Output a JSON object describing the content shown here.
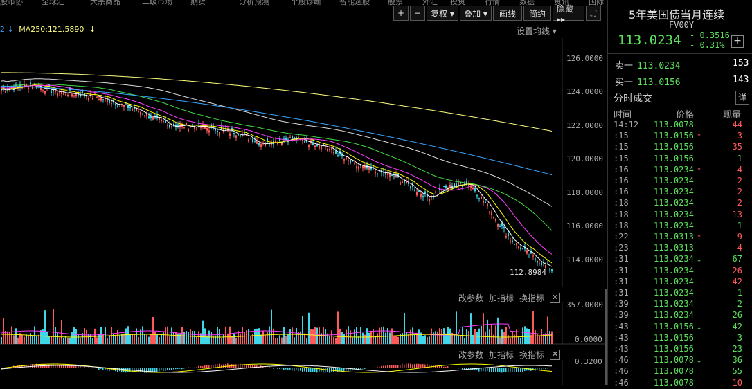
{
  "nav": {
    "items": [
      "股市协",
      "全球汇",
      "大宗商品",
      "二级市场",
      "期货",
      "分析预测",
      "个股诊断",
      "智能选股",
      "股票",
      "外汇",
      "投资",
      "行情",
      "数据",
      "资讯",
      "国际"
    ]
  },
  "toolbar": {
    "plus": "+",
    "minus": "−",
    "fuquan": "复权 ▾",
    "diejia": "叠加 ▾",
    "huaxian": "画线",
    "jianyue": "简约",
    "yincang": "隐藏 ▸▸",
    "fullscreen": "⛶"
  },
  "ma_bar": {
    "prefix": "2 ↓",
    "ma250": "MA250:121.5890",
    "arrow": "↓",
    "set_ma": "设置均线 ▾"
  },
  "y_axis": [
    "126.0000",
    "124.0000",
    "122.0000",
    "120.0000",
    "118.0000",
    "116.0000",
    "114.0000"
  ],
  "latest_label": "112.8984",
  "volume_panel": {
    "gaicanshu": "改参数",
    "jiazhibiao": "加指标",
    "huanzhibiao": "换指标",
    "close": "✕",
    "max": "357.0000",
    "min": "0.0000"
  },
  "macd_panel": {
    "gaicanshu": "改参数",
    "jiazhibiao": "加指标",
    "huanzhibiao": "换指标",
    "close": "✕",
    "max": "0.3200"
  },
  "side": {
    "title": "5年美国债当月连续",
    "code": "FV00Y",
    "price": "113.0234",
    "change": "- 0.3516",
    "change_pct": "- 0.31%",
    "plus": "+",
    "ask_label": "卖一",
    "ask_price": "113.0234",
    "ask_vol": "153",
    "bid_label": "买一",
    "bid_price": "113.0156",
    "bid_vol": "143",
    "ticks_title": "分时成交",
    "detail": "详",
    "col_time": "时间",
    "col_price": "价格",
    "col_vol": "现量"
  },
  "ticks": [
    {
      "t": "14:12",
      "p": "113.0078",
      "a": "",
      "v": "44",
      "c": "up"
    },
    {
      "t": ":15",
      "p": "113.0156",
      "a": "↑",
      "v": "3",
      "c": "up"
    },
    {
      "t": ":15",
      "p": "113.0156",
      "a": "",
      "v": "35",
      "c": "up"
    },
    {
      "t": ":15",
      "p": "113.0156",
      "a": "",
      "v": "1",
      "c": "dn"
    },
    {
      "t": ":16",
      "p": "113.0234",
      "a": "↑",
      "v": "4",
      "c": "up"
    },
    {
      "t": ":16",
      "p": "113.0234",
      "a": "",
      "v": "2",
      "c": "up"
    },
    {
      "t": ":16",
      "p": "113.0234",
      "a": "",
      "v": "2",
      "c": "up"
    },
    {
      "t": ":18",
      "p": "113.0234",
      "a": "",
      "v": "2",
      "c": "up"
    },
    {
      "t": ":18",
      "p": "113.0234",
      "a": "",
      "v": "13",
      "c": "up"
    },
    {
      "t": ":18",
      "p": "113.0234",
      "a": "",
      "v": "1",
      "c": "dn"
    },
    {
      "t": ":22",
      "p": "113.0313",
      "a": "↑",
      "v": "9",
      "c": "up"
    },
    {
      "t": ":23",
      "p": "113.0313",
      "a": "",
      "v": "4",
      "c": "up"
    },
    {
      "t": ":31",
      "p": "113.0234",
      "a": "↓",
      "v": "67",
      "c": "dn"
    },
    {
      "t": ":31",
      "p": "113.0234",
      "a": "",
      "v": "26",
      "c": "up"
    },
    {
      "t": ":31",
      "p": "113.0234",
      "a": "",
      "v": "42",
      "c": "up"
    },
    {
      "t": ":31",
      "p": "113.0234",
      "a": "",
      "v": "1",
      "c": "dn"
    },
    {
      "t": ":39",
      "p": "113.0234",
      "a": "",
      "v": "2",
      "c": "dn"
    },
    {
      "t": ":39",
      "p": "113.0234",
      "a": "",
      "v": "26",
      "c": "dn"
    },
    {
      "t": ":43",
      "p": "113.0156",
      "a": "↓",
      "v": "42",
      "c": "dn"
    },
    {
      "t": ":43",
      "p": "113.0156",
      "a": "",
      "v": "3",
      "c": "dn"
    },
    {
      "t": ":43",
      "p": "113.0156",
      "a": "",
      "v": "23",
      "c": "dn"
    },
    {
      "t": ":46",
      "p": "113.0078",
      "a": "↓",
      "v": "36",
      "c": "dn"
    },
    {
      "t": ":46",
      "p": "113.0078",
      "a": "",
      "v": "55",
      "c": "dn"
    },
    {
      "t": ":46",
      "p": "113.0078",
      "a": "",
      "v": "10",
      "c": "up"
    }
  ],
  "colors": {
    "up": "#ff5a5a",
    "down": "#3fd6e8",
    "ma5": "#ffffff",
    "ma10": "#ffff00",
    "ma20": "#ff40ff",
    "ma60": "#44dd44",
    "ma120": "#dddddd",
    "ma250_a": "#3aa6ff",
    "ma250_b": "#ffff80"
  }
}
